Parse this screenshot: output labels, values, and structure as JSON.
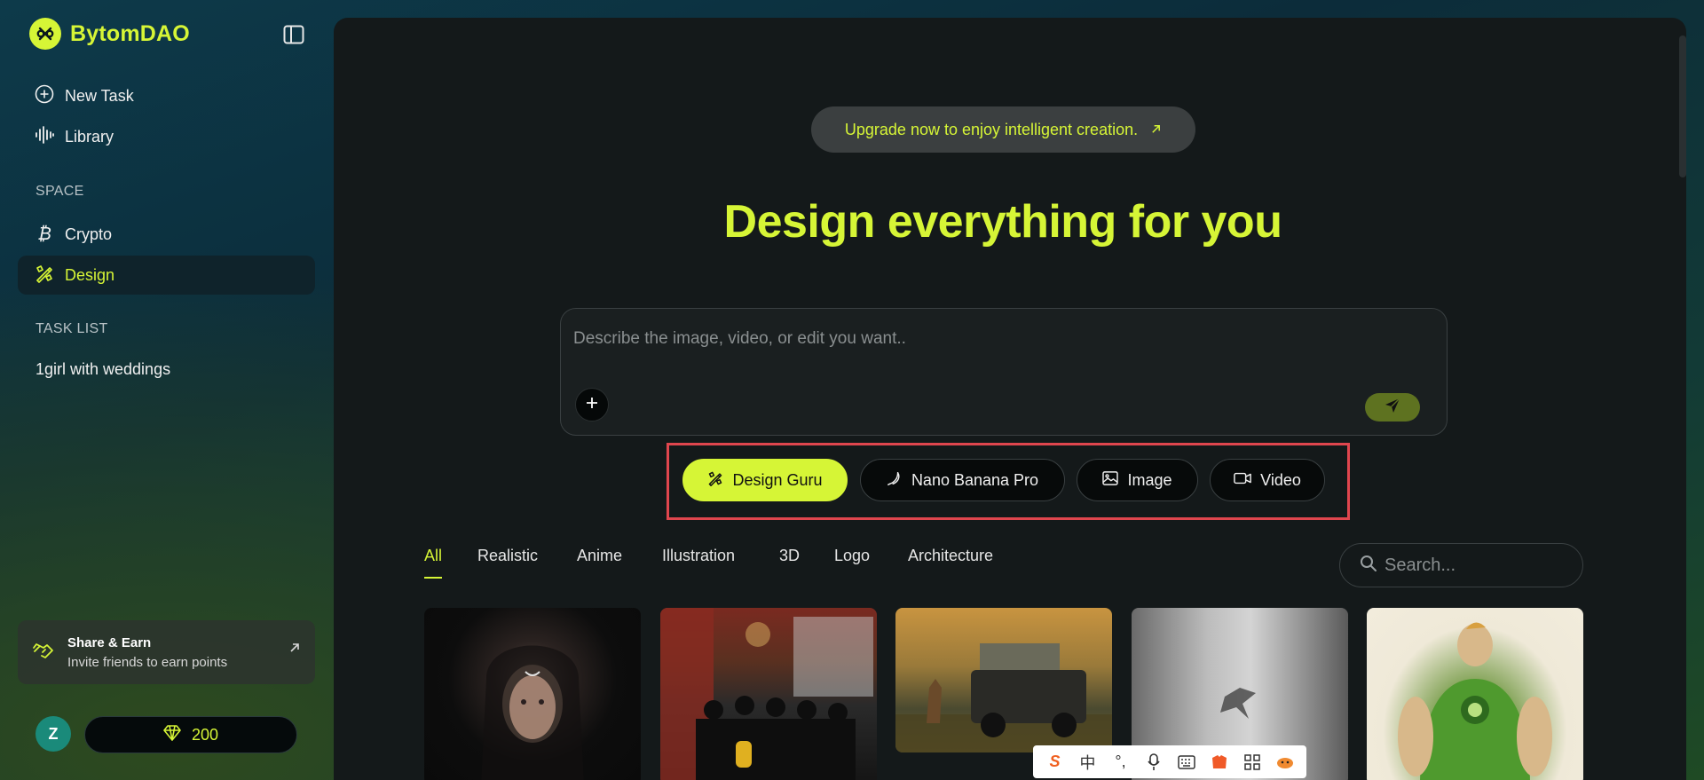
{
  "app": {
    "name": "BytomDAO",
    "accent": "#d6f536"
  },
  "sidebar": {
    "nav": [
      {
        "label": "New Task",
        "icon": "plus-circle-icon"
      },
      {
        "label": "Library",
        "icon": "waveform-icon"
      }
    ],
    "space_label": "SPACE",
    "space_items": [
      {
        "label": "Crypto",
        "icon": "bitcoin-icon"
      },
      {
        "label": "Design",
        "icon": "design-tools-icon",
        "active": true
      }
    ],
    "task_list_label": "TASK LIST",
    "tasks": [
      {
        "label": "1girl with weddings"
      }
    ],
    "share": {
      "title": "Share & Earn",
      "subtitle": "Invite friends to earn points"
    },
    "user": {
      "initial": "Z",
      "points": "200"
    }
  },
  "main": {
    "upgrade_text": "Upgrade now to enjoy intelligent creation.",
    "hero_title": "Design everything for you",
    "prompt": {
      "placeholder": "Describe the image, video, or edit you want..",
      "value": ""
    },
    "modes": [
      {
        "label": "Design Guru",
        "icon": "design-tools-icon",
        "active": true
      },
      {
        "label": "Nano Banana Pro",
        "icon": "banana-icon"
      },
      {
        "label": "Image",
        "icon": "image-icon"
      },
      {
        "label": "Video",
        "icon": "video-camera-icon"
      }
    ],
    "tabs": [
      "All",
      "Realistic",
      "Anime",
      "Illustration",
      "3D",
      "Logo",
      "Architecture"
    ],
    "active_tab": "All",
    "search": {
      "placeholder": "Search..."
    },
    "gallery": [
      {
        "subject": "dark-haired woman portrait"
      },
      {
        "subject": "group in dim restaurant"
      },
      {
        "subject": "kangaroo by off-road vehicle"
      },
      {
        "subject": "bird tattoo on arm"
      },
      {
        "subject": "green muscular superhero"
      }
    ]
  },
  "ime": {
    "chinese_char": "中",
    "punct": "°,"
  }
}
